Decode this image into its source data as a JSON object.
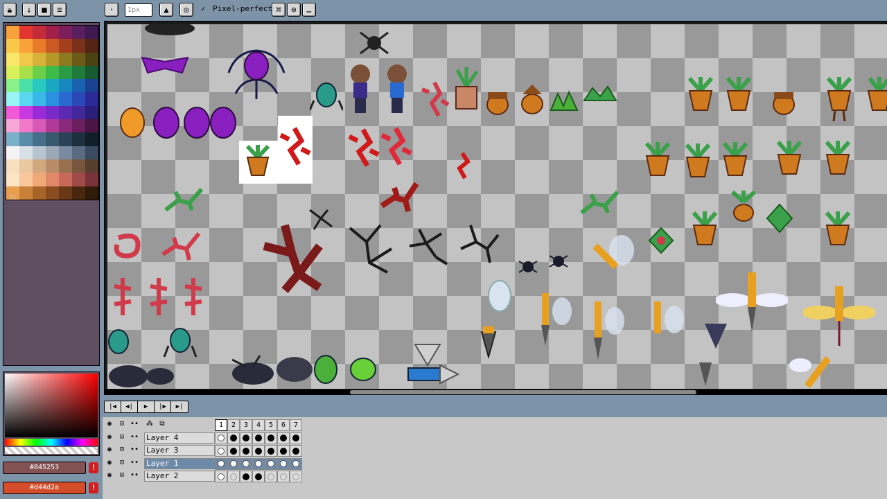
{
  "toolbar": {
    "brush_size_value": "1px",
    "pixel_perfect_checkbox_mark": "✓",
    "pixel_perfect_label": "Pixel-perfect"
  },
  "palette": {
    "colors": [
      "#f7a23a",
      "#e2352f",
      "#c42a3a",
      "#a21f4a",
      "#7b1e5a",
      "#5a1d5d",
      "#3e1a50",
      "#f9c84a",
      "#f9a23a",
      "#e87a2a",
      "#c95a22",
      "#a33f1d",
      "#7a3019",
      "#542515",
      "#f9e76a",
      "#f2c84a",
      "#d6b23a",
      "#b6982a",
      "#8e7a20",
      "#6a5c18",
      "#4a4212",
      "#d9f05a",
      "#a8e04a",
      "#6ccf4a",
      "#3dbb48",
      "#2a9a44",
      "#1f7a3c",
      "#165a32",
      "#8af08a",
      "#4ae0a8",
      "#2ac8c0",
      "#1aa8c0",
      "#1a88c0",
      "#1a62b0",
      "#1a4290",
      "#9af4f4",
      "#5ad8f0",
      "#3ab8e8",
      "#2a90e0",
      "#2a6ad0",
      "#2a48b8",
      "#2a2a98",
      "#f05ad8",
      "#c83ae0",
      "#9a2ad8",
      "#7a2ac8",
      "#5a2ab0",
      "#42289a",
      "#2a1e78",
      "#f8a8d8",
      "#f07ac8",
      "#d85ab8",
      "#b03a98",
      "#8a2a7a",
      "#6a1e5e",
      "#4a1444",
      "#7ab0c8",
      "#5a8ca8",
      "#466e8a",
      "#38586e",
      "#2a4256",
      "#1e3040",
      "#121e2a",
      "#f4f4f4",
      "#d8e0e8",
      "#b8c4d0",
      "#9aa8b8",
      "#7a8aa0",
      "#5a6a80",
      "#3a4a60",
      "#f6e0c0",
      "#e8c8a0",
      "#d0a880",
      "#b88c68",
      "#987050",
      "#78563e",
      "#583e2c",
      "#fbe4c4",
      "#f8c89a",
      "#f0a878",
      "#e08868",
      "#c8685a",
      "#a04a4a",
      "#7a323a",
      "#e8a050",
      "#c88038",
      "#a86428",
      "#884c1e",
      "#683816",
      "#4a2810",
      "#301a0a"
    ],
    "marker": "II"
  },
  "colors": {
    "primary_hex": "#845253",
    "primary_bg": "#845253",
    "secondary_hex": "#d44d2a",
    "secondary_bg": "#d44d2a",
    "warning_glyph": "!"
  },
  "timeline": {
    "frames": [
      "1",
      "2",
      "3",
      "4",
      "5",
      "6",
      "7"
    ],
    "layers": [
      {
        "name": "Layer 4",
        "cels": [
          "white",
          "full",
          "full",
          "full",
          "full",
          "full",
          "full"
        ]
      },
      {
        "name": "Layer 3",
        "cels": [
          "white",
          "full",
          "full",
          "full",
          "full",
          "full",
          "full"
        ]
      },
      {
        "name": "Layer 1",
        "cels": [
          "white",
          "white",
          "white",
          "white",
          "white",
          "white",
          "white"
        ],
        "selected": true
      },
      {
        "name": "Layer 2",
        "cels": [
          "white",
          "empty",
          "full",
          "full",
          "empty",
          "empty",
          "empty"
        ]
      }
    ]
  }
}
